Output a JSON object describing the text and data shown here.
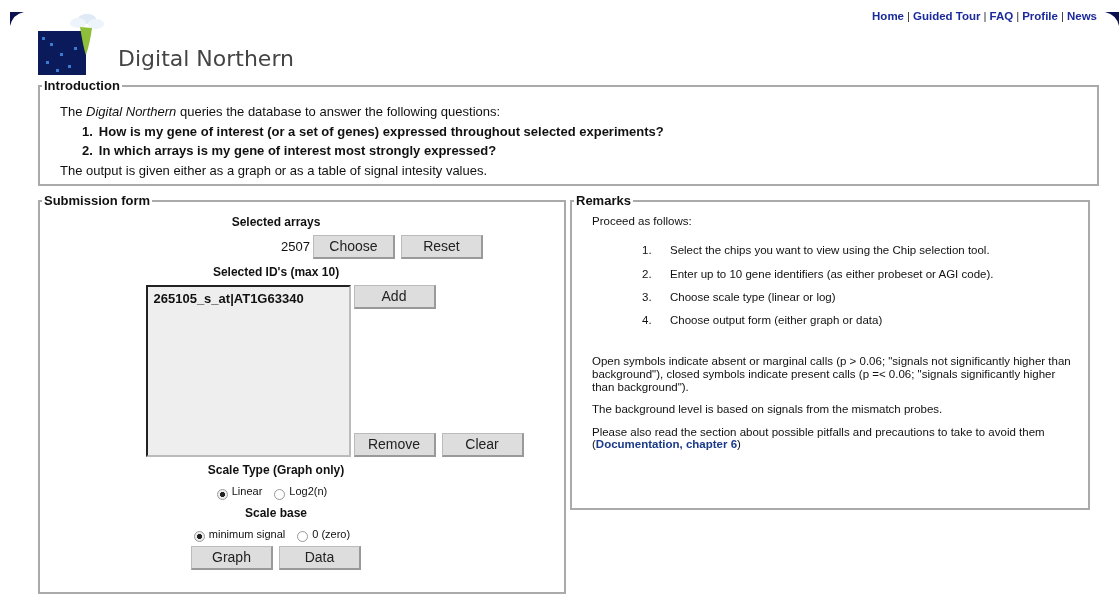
{
  "nav_links": [
    "Home",
    "Guided Tour",
    "FAQ",
    "Profile",
    "News"
  ],
  "nav_separator": "|",
  "site_title": "Digital Northern",
  "introduction": {
    "legend": "Introduction",
    "lead": "The *Digital Northern* queries the database to answer the following questions:",
    "questions": [
      {
        "number": "1.",
        "text": "How is my gene of interest (or a set of genes) expressed throughout selected experiments?"
      },
      {
        "number": "2.",
        "text": "In which arrays is my gene of interest most strongly expressed?"
      }
    ],
    "closing": "The output is given either as a graph or as a table of signal intesity values."
  },
  "submission_form": {
    "legend": "Submission form",
    "selected_arrays_label": "Selected arrays",
    "selected_arrays_value": "2507",
    "array_buttons": [
      "Choose",
      "Reset"
    ],
    "ids_label": "Selected ID's (max 10)",
    "ids": [
      "265105_s_at|AT1G63340"
    ],
    "add_button": "Add",
    "list_buttons": [
      "Remove",
      "Clear"
    ],
    "scale_type_label": "Scale Type (Graph only)",
    "scale_type": [
      {
        "label": "Linear",
        "selected": true
      },
      {
        "label": "Log2(n)",
        "selected": false
      }
    ],
    "scale_base_label": "Scale base",
    "scale_base": [
      {
        "label": "minimum signal",
        "selected": true
      },
      {
        "label": "0 (zero)",
        "selected": false
      }
    ],
    "output_buttons": [
      "Graph",
      "Data"
    ]
  },
  "remarks": {
    "legend": "Remarks",
    "lead": "Proceed as follows:",
    "steps": [
      {
        "number": "1.",
        "text": "Select the chips you want to view using the Chip selection tool."
      },
      {
        "number": "2.",
        "text": "Enter up to 10 gene identifiers (as either probeset or AGI code)."
      },
      {
        "number": "3.",
        "text": "Choose scale type (linear or log)"
      },
      {
        "number": "4.",
        "text": "Choose output form (either graph or data)"
      }
    ],
    "notes": [
      "Open symbols indicate absent or marginal calls (p > 0.06; \"signals not significantly higher than background\"), closed symbols indicate present calls (p =< 0.06; \"signals significantly higher than background\").",
      "The background level is based on signals from the mismatch probes."
    ],
    "pitfalls_text": "Please also read the section about possible pitfalls and precautions to take to avoid them (",
    "pitfalls_link": "Documentation, chapter 6",
    "pitfalls_end": ")"
  }
}
